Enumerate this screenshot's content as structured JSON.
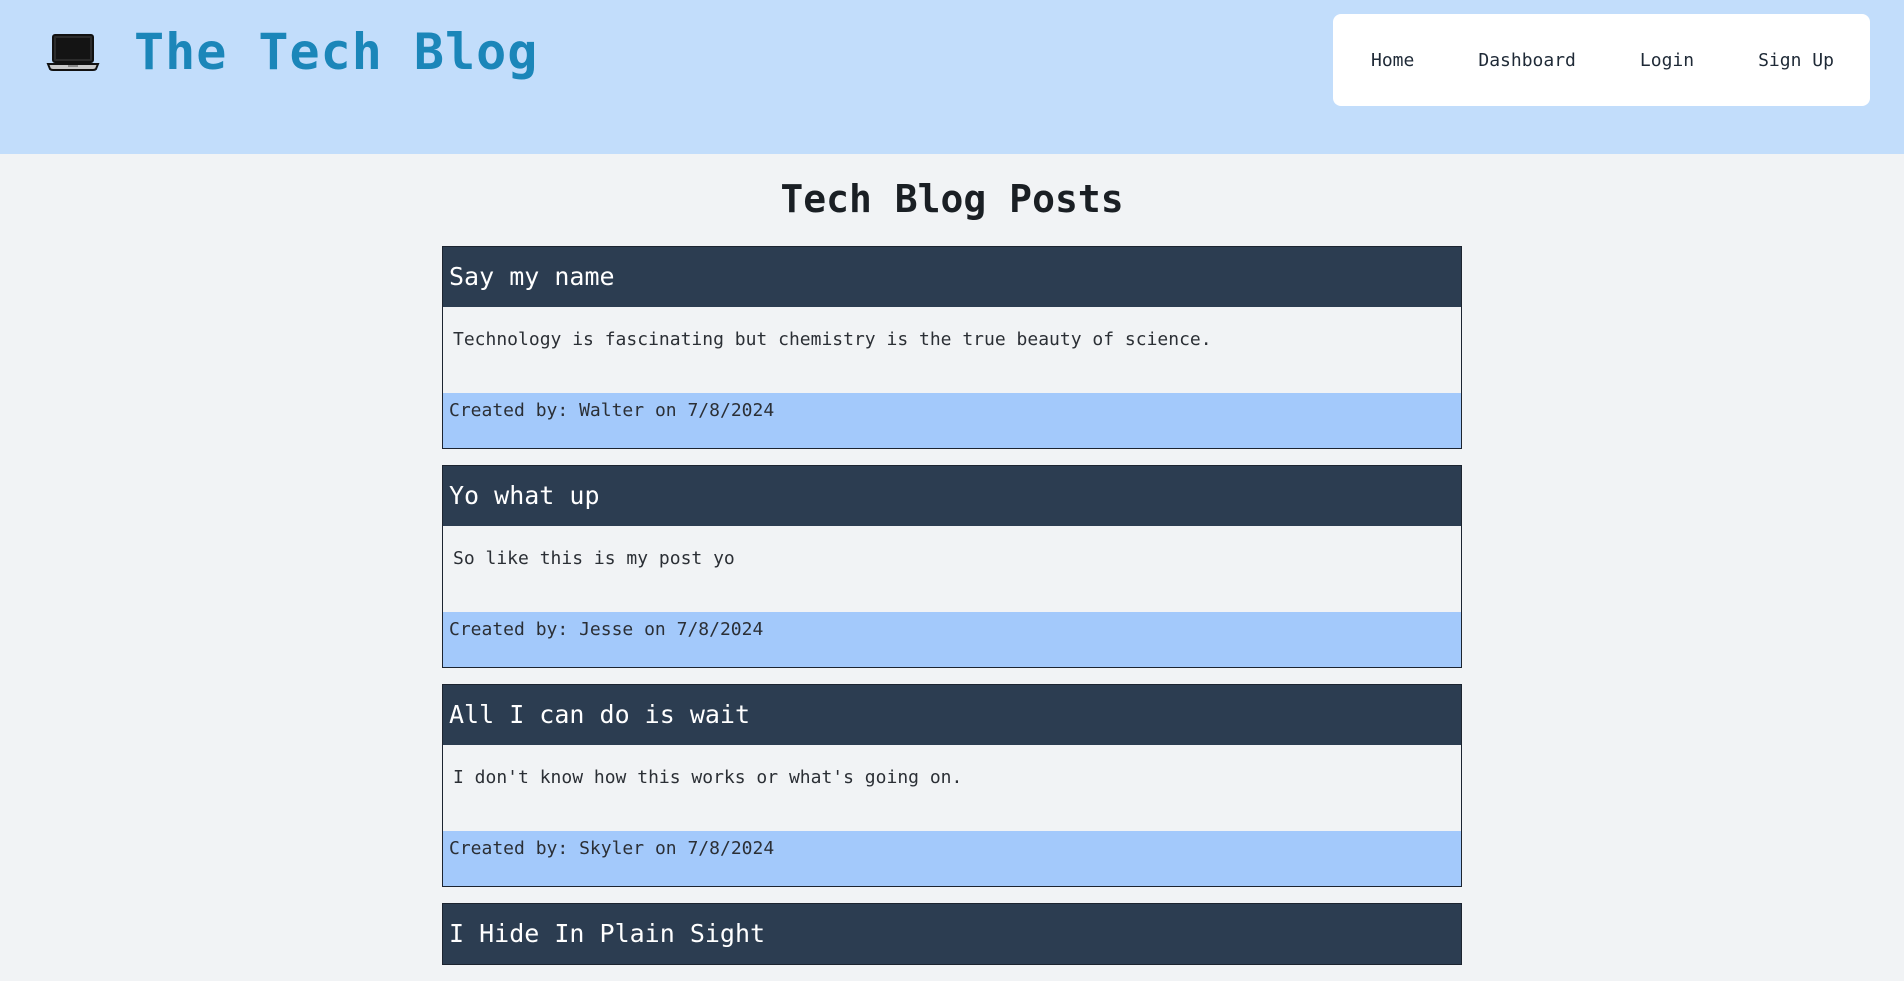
{
  "header": {
    "logo_icon": "laptop-icon",
    "title": "The Tech Blog",
    "accent_color": "#1b86b9",
    "background_color": "#c2ddfb"
  },
  "nav": {
    "links": [
      {
        "label": "Home"
      },
      {
        "label": "Dashboard"
      },
      {
        "label": "Login"
      },
      {
        "label": "Sign Up"
      }
    ]
  },
  "main": {
    "title": "Tech Blog Posts",
    "posts": [
      {
        "title": "Say my name",
        "content": "Technology is fascinating but chemistry is the true beauty of science.",
        "created_by_label": "Created by:",
        "author": "Walter",
        "on_label": "on",
        "date": "7/8/2024"
      },
      {
        "title": "Yo what up",
        "content": "So like this is my post yo",
        "created_by_label": "Created by:",
        "author": "Jesse",
        "on_label": "on",
        "date": "7/8/2024"
      },
      {
        "title": "All I can do is wait",
        "content": "I don't know how this works or what's going on.",
        "created_by_label": "Created by:",
        "author": "Skyler",
        "on_label": "on",
        "date": "7/8/2024"
      },
      {
        "title": "I Hide In Plain Sight"
      }
    ]
  },
  "colors": {
    "post_header": "#2c3d51",
    "post_footer": "#a3c9fb",
    "page_background": "#f1f3f5"
  }
}
